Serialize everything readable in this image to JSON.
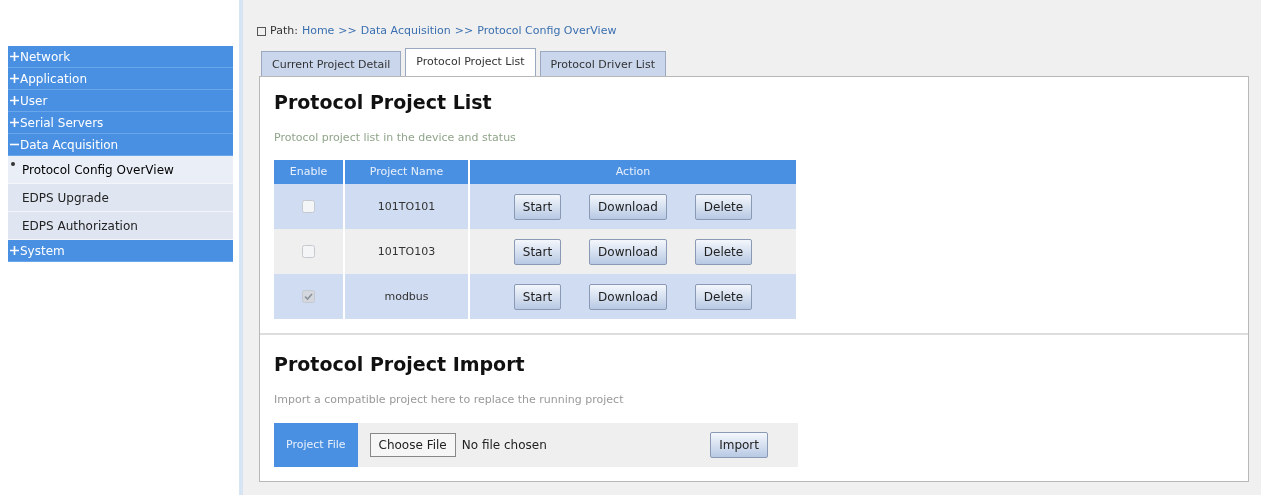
{
  "sidebar": {
    "items": [
      {
        "label": "Network",
        "expanded": false
      },
      {
        "label": "Application",
        "expanded": false
      },
      {
        "label": "User",
        "expanded": false
      },
      {
        "label": "Serial Servers",
        "expanded": false
      },
      {
        "label": "Data Acquisition",
        "expanded": true,
        "children": [
          {
            "label": "Protocol Config OverView",
            "selected": true
          },
          {
            "label": "EDPS Upgrade",
            "selected": false
          },
          {
            "label": "EDPS Authorization",
            "selected": false
          }
        ]
      },
      {
        "label": "System",
        "expanded": false
      }
    ]
  },
  "breadcrumb": {
    "label": "Path:",
    "items": [
      "Home",
      ">>",
      "Data Acquisition",
      ">>",
      "Protocol Config OverView"
    ]
  },
  "tabs": [
    {
      "label": "Current Project Detail",
      "selected": false
    },
    {
      "label": "Protocol Project List",
      "selected": true
    },
    {
      "label": "Protocol Driver List",
      "selected": false
    }
  ],
  "project_list": {
    "title": "Protocol Project List",
    "subtitle": "Protocol project list in the device and status",
    "columns": [
      "Enable",
      "Project Name",
      "Action"
    ],
    "rows": [
      {
        "checked": false,
        "name": "101TO101",
        "actions": [
          "Start",
          "Download",
          "Delete"
        ]
      },
      {
        "checked": false,
        "name": "101TO103",
        "actions": [
          "Start",
          "Download",
          "Delete"
        ]
      },
      {
        "checked": true,
        "name": "modbus",
        "actions": [
          "Start",
          "Download",
          "Delete"
        ]
      }
    ]
  },
  "project_import": {
    "title": "Protocol Project Import",
    "subtitle": "Import a compatible project here to replace the running project",
    "field_label": "Project File",
    "choose_button": "Choose File",
    "file_status": "No file chosen",
    "import_button": "Import"
  }
}
